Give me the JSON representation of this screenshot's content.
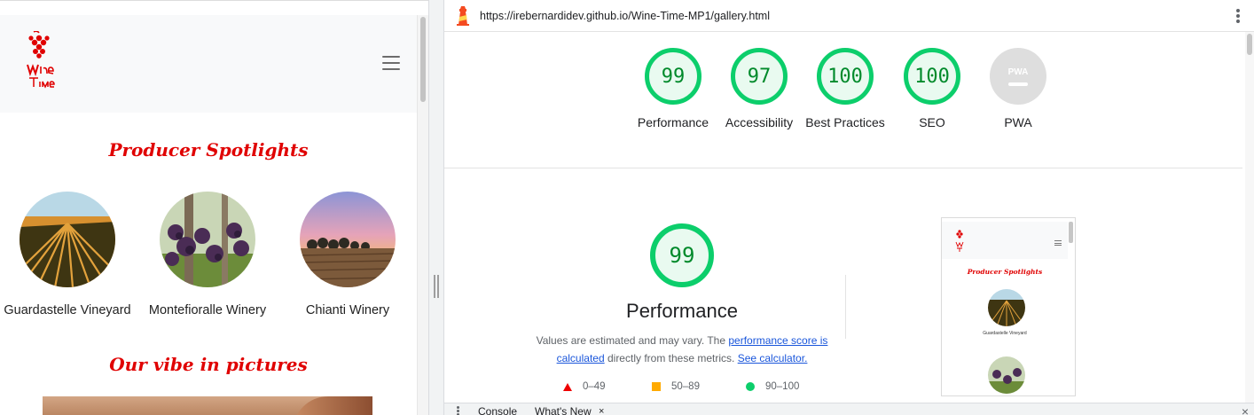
{
  "site": {
    "logo_text": "Wine Time",
    "menu_icon": "hamburger-icon",
    "spotlight_heading": "Producer Spotlights",
    "producers": [
      {
        "name": "Guardastelle Vineyard"
      },
      {
        "name": "Montefioralle Winery"
      },
      {
        "name": "Chianti Winery"
      }
    ],
    "vibe_heading": "Our vibe in pictures"
  },
  "lighthouse": {
    "url": "https://irebernardidev.github.io/Wine-Time-MP1/gallery.html",
    "categories": [
      {
        "label": "Performance",
        "score": "99"
      },
      {
        "label": "Accessibility",
        "score": "97"
      },
      {
        "label": "Best Practices",
        "score": "100"
      },
      {
        "label": "SEO",
        "score": "100"
      },
      {
        "label": "PWA",
        "score": "PWA"
      }
    ],
    "performance": {
      "score": "99",
      "title": "Performance",
      "note_prefix": "Values are estimated and may vary. The ",
      "note_link1": "performance score is calculated",
      "note_middle": " directly from these metrics. ",
      "note_link2": "See calculator."
    },
    "legend": [
      {
        "range": "0–49",
        "color": "#e00000"
      },
      {
        "range": "50–89",
        "color": "#ffaa00"
      },
      {
        "range": "90–100",
        "color": "#0cce6b"
      }
    ],
    "thumbnail": {
      "heading": "Producer Spotlights",
      "caption": "Guardastelle Vineyard"
    }
  },
  "drawer": {
    "tab_console": "Console",
    "tab_whats_new": "What's New",
    "tab_close": "×",
    "close": "×"
  },
  "colors": {
    "pass": "#0cce6b",
    "pass_text": "#008a2b",
    "brand_red": "#e00000"
  }
}
